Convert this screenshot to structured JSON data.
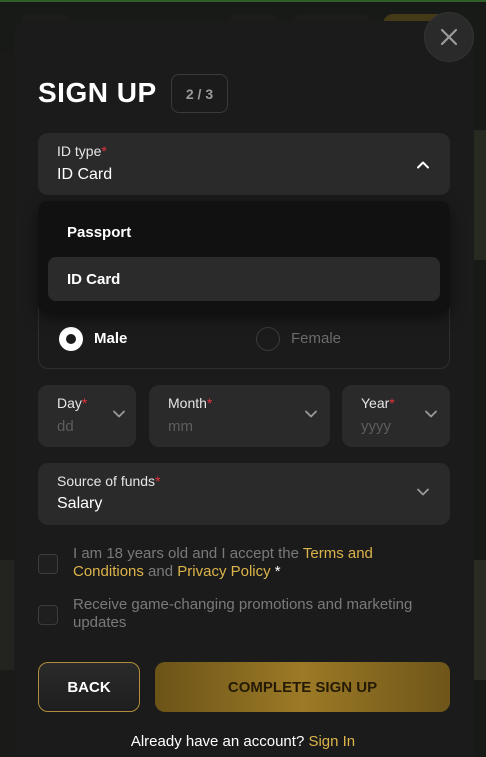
{
  "colors": {
    "accent_gold": "#dcb44a",
    "required_red": "#e5333f",
    "modal_bg": "#1b1b1b",
    "field_bg": "#2a2a2a"
  },
  "modal": {
    "title": "SIGN UP",
    "step": "2 / 3",
    "close_icon": "close-icon"
  },
  "id_type": {
    "label": "ID type",
    "required_mark": "*",
    "value": "ID Card",
    "options": [
      "Passport",
      "ID Card"
    ],
    "selected": "ID Card"
  },
  "gender": {
    "options": [
      "Male",
      "Female"
    ],
    "selected": "Male"
  },
  "dob": {
    "day": {
      "label": "Day",
      "required_mark": "*",
      "placeholder": "dd"
    },
    "month": {
      "label": "Month",
      "required_mark": "*",
      "placeholder": "mm"
    },
    "year": {
      "label": "Year",
      "required_mark": "*",
      "placeholder": "yyyy"
    }
  },
  "source_of_funds": {
    "label": "Source of funds",
    "required_mark": "*",
    "value": "Salary"
  },
  "consent": {
    "terms_prefix": "I am 18 years old and I accept the ",
    "terms_link": "Terms and Conditions",
    "terms_and": " and ",
    "privacy_link": "Privacy Policy",
    "terms_required": " *",
    "promotions": "Receive game-changing promotions and marketing updates"
  },
  "actions": {
    "back": "BACK",
    "complete": "COMPLETE SIGN UP"
  },
  "footer": {
    "prompt": "Already have an account? ",
    "sign_in": "Sign In"
  }
}
